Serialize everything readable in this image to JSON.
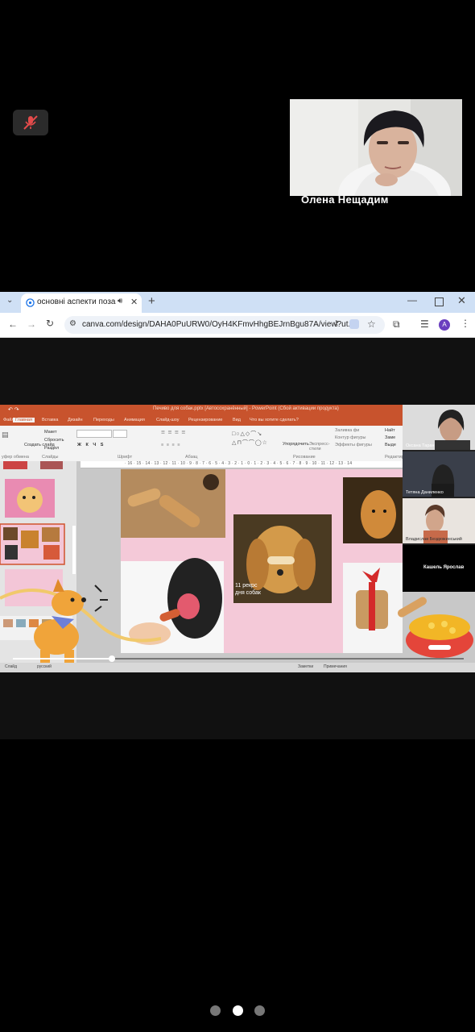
{
  "call": {
    "mute_icon": "mic-off-icon",
    "presenter_name": "Олена Нещадим"
  },
  "browser": {
    "tab_title": "основні аспекти позаауди",
    "tab_icons": [
      "chevron-down-icon",
      "globe-icon",
      "speaker-icon",
      "close-icon",
      "plus-icon"
    ],
    "window_controls": [
      "minimize-icon",
      "maximize-icon",
      "close-icon"
    ],
    "url": "canva.com/design/DAHA0PuURW0/OyH4KFmvHhgBEJrnBgu87A/view?ut...",
    "avatar_letter": "A",
    "accent": "#6a3fbf"
  },
  "ppt": {
    "title": "Печиво для собак.pptx [Автосохранённый] - PowerPoint (Сбой активации продукта)",
    "tabs": [
      "Файл",
      "Главная",
      "Вставка",
      "Дизайн",
      "Переходы",
      "Анимация",
      "Слайд-шоу",
      "Рецензирование",
      "Вид",
      "Что вы хотите сделать?"
    ],
    "ribbon": {
      "create_slide": "Создать слайд",
      "layout": "Макет",
      "reset": "Сбросить",
      "section": "Раздел",
      "group_slides": "Слайды",
      "group_font": "Шрифт",
      "group_paragraph": "Абзац",
      "group_drawing": "Рисование",
      "group_edit": "Редактир",
      "arrange": "Упорядочить",
      "quick_styles": "Экспресс-стили",
      "fill": "Заливка фи",
      "outline": "Контур фигуры",
      "effects": "Эффекты фигуры",
      "find": "Найт",
      "replace": "Заме",
      "select": "Выде",
      "clipboard": "уфер обмена"
    },
    "ruler": "· 16 · 15 · 14 · 13 · 12 · 11 · 10 · 9 · 8 · 7 · 6 · 5 · 4 · 3 · 2 · 1 · 0 · 1 · 2 · 3 · 4 · 5 · 6 · 7 · 8 · 9 · 10 · 11 · 12 · 13 · 14",
    "caption": "11 рекрс\nдня собак",
    "status": [
      "Слайд",
      "русский",
      "Заметки",
      "Примечания"
    ]
  },
  "gallery": [
    {
      "name": "Оксана Таран"
    },
    {
      "name": "Тетяна Даниленко"
    },
    {
      "name": "Владислав Бездюжинський"
    },
    {
      "name": "Кашель Ярослав"
    }
  ],
  "playback": {
    "progress": 0.22
  },
  "pager": {
    "count": 3,
    "active": 1
  }
}
